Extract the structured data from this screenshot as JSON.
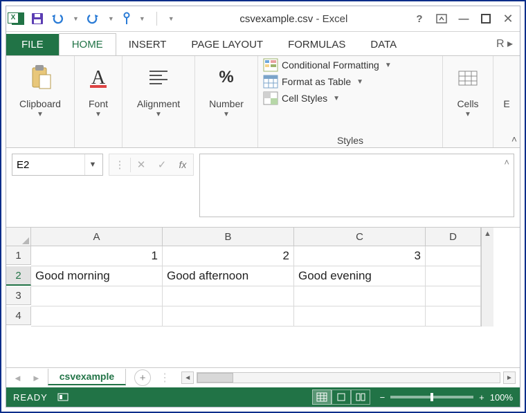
{
  "title": {
    "filename": "csvexample.csv",
    "app": "Excel"
  },
  "tabs": {
    "file": "FILE",
    "home": "HOME",
    "insert": "INSERT",
    "page_layout": "PAGE LAYOUT",
    "formulas": "FORMULAS",
    "data": "DATA",
    "overflow": "R"
  },
  "ribbon": {
    "clipboard": "Clipboard",
    "font": "Font",
    "alignment": "Alignment",
    "number": "Number",
    "styles": {
      "cond_fmt": "Conditional Formatting",
      "fmt_table": "Format as Table",
      "cell_styles": "Cell Styles",
      "label": "Styles"
    },
    "cells": "Cells",
    "editing": "E"
  },
  "formula_bar": {
    "namebox": "E2",
    "fx": "fx"
  },
  "grid": {
    "cols": [
      "A",
      "B",
      "C",
      "D"
    ],
    "rows": [
      "1",
      "2",
      "3",
      "4"
    ],
    "data": {
      "r1": {
        "A": "1",
        "B": "2",
        "C": "3"
      },
      "r2": {
        "A": "Good morning",
        "B": "Good afternoon",
        "C": "Good evening"
      }
    }
  },
  "sheet": {
    "name": "csvexample"
  },
  "status": {
    "ready": "READY",
    "zoom": "100%"
  }
}
